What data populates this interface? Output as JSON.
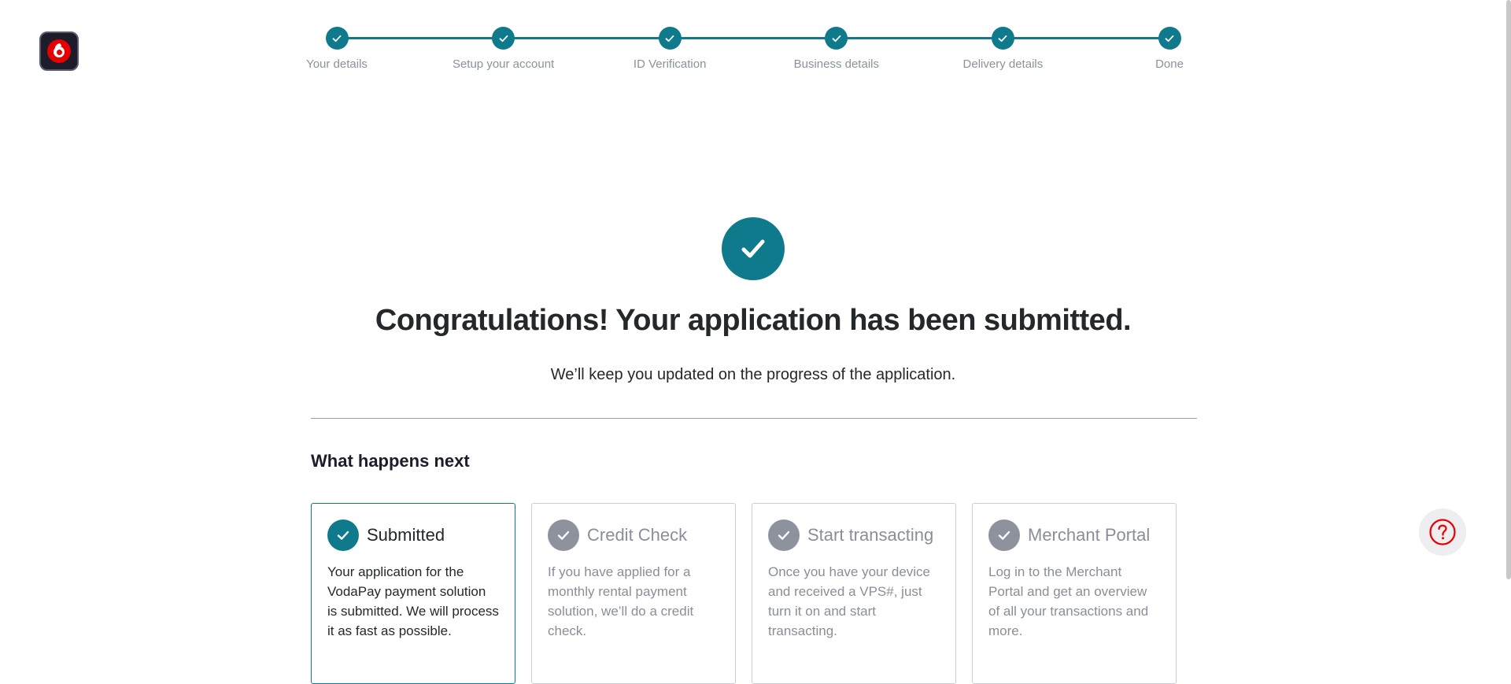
{
  "brand": {
    "logo_icon": "vodafone-logo-icon",
    "accent_color": "#0f7a8c",
    "logo_red": "#e60000"
  },
  "stepper": {
    "steps": [
      {
        "label": "Your details",
        "status": "complete"
      },
      {
        "label": "Setup your account",
        "status": "complete"
      },
      {
        "label": "ID Verification",
        "status": "complete"
      },
      {
        "label": "Business details",
        "status": "complete"
      },
      {
        "label": "Delivery details",
        "status": "complete"
      },
      {
        "label": "Done",
        "status": "complete"
      }
    ]
  },
  "confirmation": {
    "headline": "Congratulations! Your application has been submitted.",
    "subline": "We’ll keep you updated on the progress of the application."
  },
  "next_steps": {
    "title": "What happens next",
    "cards": [
      {
        "title": "Submitted",
        "body": "Your application for the VodaPay payment solution is submitted. We will process it as fast as possible.",
        "active": true
      },
      {
        "title": "Credit Check",
        "body": "If you have applied for a monthly rental payment solution, we’ll do a credit check.",
        "active": false
      },
      {
        "title": "Start transacting",
        "body": "Once you have your device and received a VPS#, just turn it on and start transacting.",
        "active": false
      },
      {
        "title": "Merchant Portal",
        "body": "Log in to the Merchant Portal and get an overview of all your transactions and more.",
        "active": false
      }
    ]
  },
  "help": {
    "icon": "question-circle-icon"
  }
}
